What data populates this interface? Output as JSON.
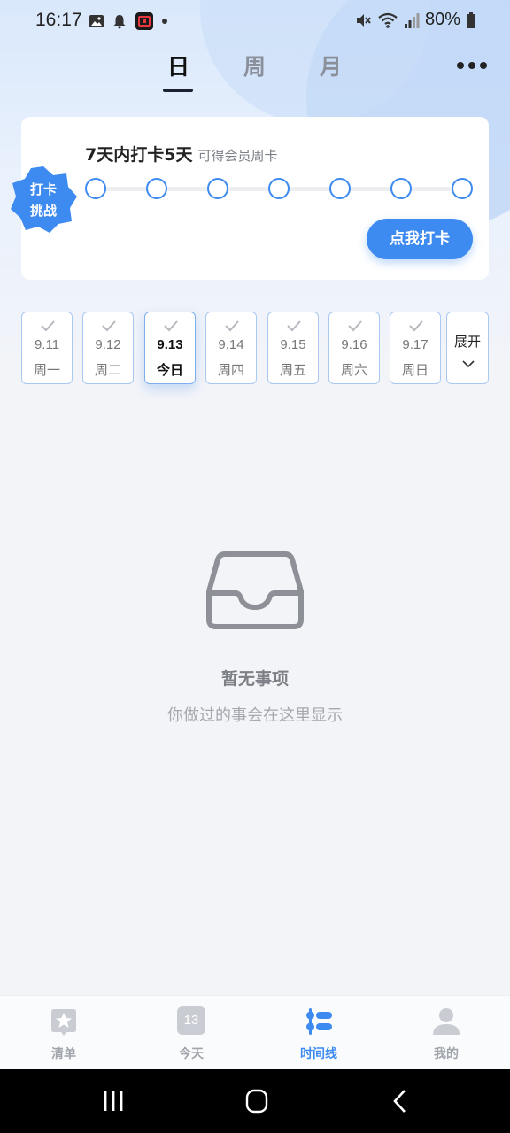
{
  "status_bar": {
    "time": "16:17",
    "battery": "80%"
  },
  "tabs": [
    {
      "label": "日",
      "active": true
    },
    {
      "label": "周",
      "active": false
    },
    {
      "label": "月",
      "active": false
    }
  ],
  "challenge": {
    "badge_line1": "打卡",
    "badge_line2": "挑战",
    "title": "7天内打卡5天",
    "subtitle": "可得会员周卡",
    "progress_done": 0,
    "progress_total": 7,
    "button_label": "点我打卡"
  },
  "dates": [
    {
      "date": "9.11",
      "weekday": "周一",
      "today": false
    },
    {
      "date": "9.12",
      "weekday": "周二",
      "today": false
    },
    {
      "date": "9.13",
      "weekday": "今日",
      "today": true
    },
    {
      "date": "9.14",
      "weekday": "周四",
      "today": false
    },
    {
      "date": "9.15",
      "weekday": "周五",
      "today": false
    },
    {
      "date": "9.16",
      "weekday": "周六",
      "today": false
    },
    {
      "date": "9.17",
      "weekday": "周日",
      "today": false
    }
  ],
  "expand_label": "展开",
  "empty_state": {
    "title": "暂无事项",
    "subtitle": "你做过的事会在这里显示"
  },
  "bottom_nav": [
    {
      "label": "清单",
      "icon": "star-list-icon",
      "active": false
    },
    {
      "label": "今天",
      "icon": "calendar-13-icon",
      "badge": "13",
      "active": false
    },
    {
      "label": "时间线",
      "icon": "timeline-icon",
      "active": true
    },
    {
      "label": "我的",
      "icon": "person-icon",
      "active": false
    }
  ],
  "colors": {
    "accent": "#3d8af0",
    "background": "#f3f4f8"
  }
}
